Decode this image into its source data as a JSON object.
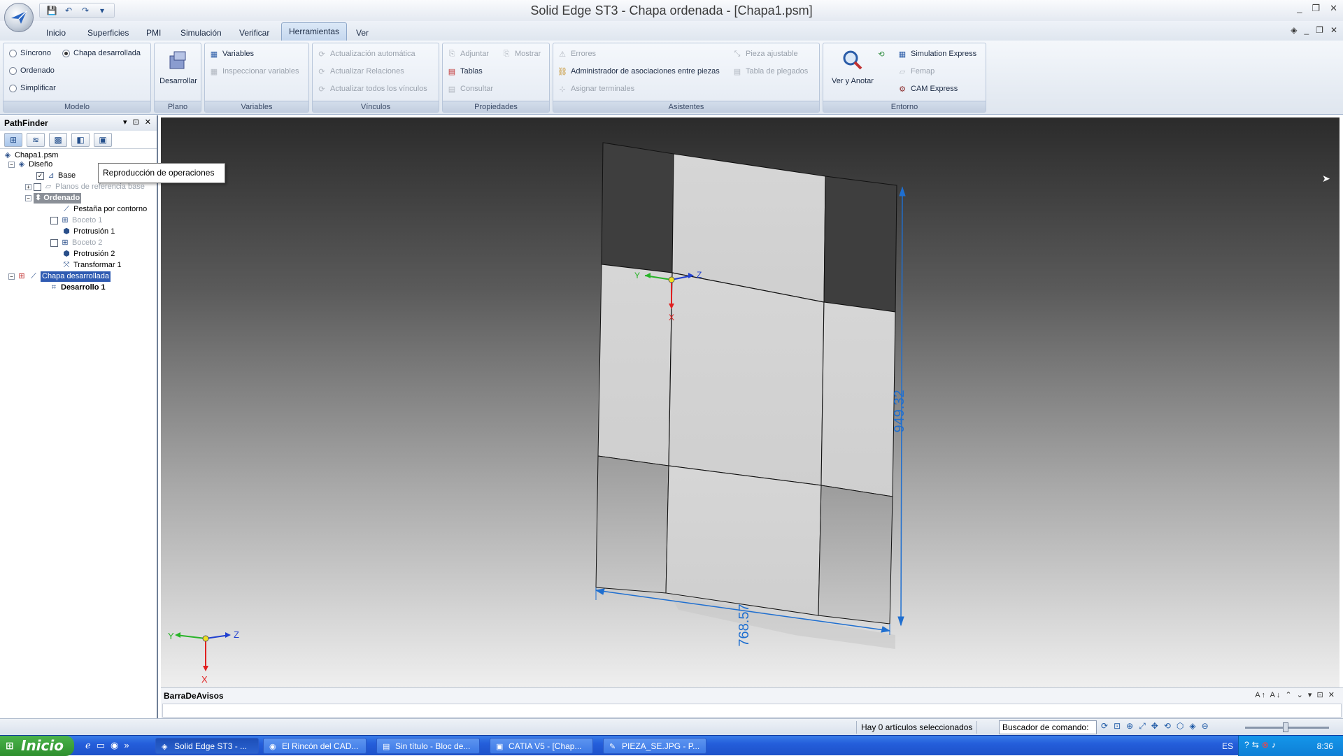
{
  "window": {
    "title": "Solid Edge ST3 - Chapa ordenada - [Chapa1.psm]",
    "minimize": "_",
    "restore": "❐",
    "close": "✕"
  },
  "qat": {
    "save_icon": "💾",
    "undo_icon": "↶",
    "redo_icon": "↷",
    "more_icon": "▾"
  },
  "tabs": [
    "Inicio",
    "Superficies",
    "PMI",
    "Simulación",
    "Verificar",
    "Herramientas",
    "Ver"
  ],
  "active_tab": "Herramientas",
  "ribbon": {
    "modelo": {
      "label": "Modelo",
      "sincrono": "Síncrono",
      "chapa_desarrollada": "Chapa desarrollada",
      "ordenado": "Ordenado",
      "simplificar": "Simplificar"
    },
    "plano": {
      "label": "Plano",
      "desarrollar": "Desarrollar"
    },
    "variables": {
      "label": "Variables",
      "variables": "Variables",
      "inspeccionar": "Inspeccionar variables"
    },
    "vinculos": {
      "label": "Vínculos",
      "actualizacion_auto": "Actualización automática",
      "actualizar_relaciones": "Actualizar Relaciones",
      "actualizar_todos": "Actualizar todos los vínculos"
    },
    "propiedades": {
      "label": "Propiedades",
      "adjuntar": "Adjuntar",
      "mostrar": "Mostrar",
      "tablas": "Tablas",
      "consultar": "Consultar"
    },
    "asistentes": {
      "label": "Asistentes",
      "errores": "Errores",
      "pieza_ajustable": "Pieza ajustable",
      "administrador": "Administrador de asociaciones entre piezas",
      "tabla_plegados": "Tabla de plegados",
      "asignar_terminales": "Asignar terminales"
    },
    "entorno": {
      "label": "Entorno",
      "ver_anotar": "Ver y Anotar",
      "simulation_express": "Simulation Express",
      "femap": "Femap",
      "cam_express": "CAM Express"
    }
  },
  "pathfinder": {
    "title": "PathFinder",
    "tooltip": "Reproducción de operaciones",
    "tree": {
      "root": "Chapa1.psm",
      "diseno": "Diseño",
      "base": "Base",
      "planos": "Planos de referencia base",
      "ordenado": "Ordenado",
      "pestana": "Pestaña por contorno",
      "boceto1": "Boceto 1",
      "protrusion1": "Protrusión 1",
      "boceto2": "Boceto 2",
      "protrusion2": "Protrusión 2",
      "transformar1": "Transformar 1",
      "chapa_desarrollada": "Chapa desarrollada",
      "desarrollo1": "Desarrollo 1"
    }
  },
  "viewport": {
    "dim_width": "768.57",
    "dim_height": "949.32",
    "axis_x": "X",
    "axis_y": "Y",
    "axis_z": "Z"
  },
  "messagebar": {
    "title": "BarraDeAvisos",
    "controls": "A↑ A↓ ⌃ ⌄ ▾ ⊡ ✕"
  },
  "status": {
    "selection": "Hay 0 artículos seleccionados",
    "command_finder": "Buscador de comando:"
  },
  "taskbar": {
    "start": "Inicio",
    "tasks": [
      {
        "label": "Solid Edge ST3 - ...",
        "icon": "◈"
      },
      {
        "label": "El Rincón del CAD...",
        "icon": "◉"
      },
      {
        "label": "Sin título - Bloc de...",
        "icon": "▤"
      },
      {
        "label": "CATIA V5 - [Chap...",
        "icon": "▣"
      },
      {
        "label": "PIEZA_SE.JPG - P...",
        "icon": "✎"
      }
    ],
    "lang": "ES",
    "clock": "8:36"
  },
  "colors": {
    "accent": "#2f5bb2",
    "dimension": "#1f6fd0",
    "axis_x": "#e02020",
    "axis_y": "#28b428",
    "axis_z": "#2040d0"
  }
}
